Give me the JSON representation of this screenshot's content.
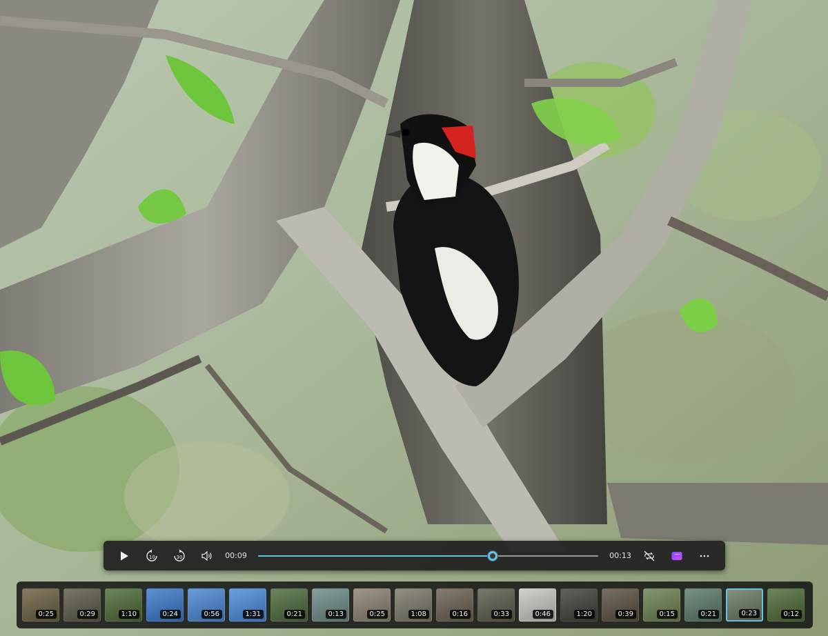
{
  "player": {
    "current_time": "00:09",
    "total_time": "00:13",
    "progress": 0.69
  },
  "icons": {
    "play": "play-icon",
    "skip_back": "skip-back-10-icon",
    "skip_forward": "skip-forward-30-icon",
    "volume": "volume-icon",
    "repeat": "repeat-off-icon",
    "clipchamp": "clipchamp-icon",
    "more": "more-icon"
  },
  "skip_back_label": "10",
  "skip_forward_label": "30",
  "colors": {
    "accent": "#60c4e8",
    "control_bg": "#202020"
  },
  "thumbnails": [
    {
      "duration": "0:25",
      "tone": "#6b6040"
    },
    {
      "duration": "0:29",
      "tone": "#5b5a48"
    },
    {
      "duration": "1:10",
      "tone": "#4e6a36"
    },
    {
      "duration": "0:24",
      "tone": "#3a78c8"
    },
    {
      "duration": "0:56",
      "tone": "#4a86d0"
    },
    {
      "duration": "1:31",
      "tone": "#4a8ad8"
    },
    {
      "duration": "0:21",
      "tone": "#4d6a3c"
    },
    {
      "duration": "0:13",
      "tone": "#6c8a88"
    },
    {
      "duration": "0:25",
      "tone": "#8a8070"
    },
    {
      "duration": "1:08",
      "tone": "#7a7868"
    },
    {
      "duration": "0:16",
      "tone": "#6a6050"
    },
    {
      "duration": "0:33",
      "tone": "#5a5a4a"
    },
    {
      "duration": "0:46",
      "tone": "#c8c6c0"
    },
    {
      "duration": "1:20",
      "tone": "#404038"
    },
    {
      "duration": "0:39",
      "tone": "#5a5040"
    },
    {
      "duration": "0:15",
      "tone": "#6a8050"
    },
    {
      "duration": "0:21",
      "tone": "#5a7a68"
    },
    {
      "duration": "0:23",
      "tone": "#6a7860",
      "selected": true
    },
    {
      "duration": "0:12",
      "tone": "#4e6a36"
    }
  ]
}
